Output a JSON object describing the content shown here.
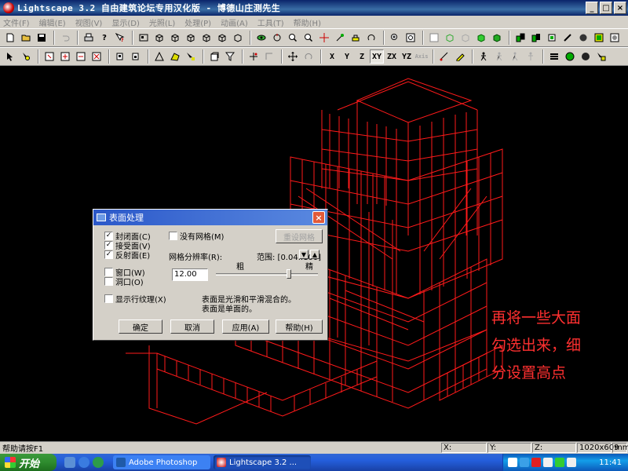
{
  "window": {
    "title": "Lightscape 3.2  自由建筑论坛专用汉化版  - 博德山庄测先生",
    "controls": [
      "_",
      "□",
      "×"
    ]
  },
  "menu": [
    "文件(F)",
    "编辑(E)",
    "视图(V)",
    "显示(D)",
    "光照(L)",
    "处理(P)",
    "动画(A)",
    "工具(T)",
    "帮助(H)"
  ],
  "toolbar2": {
    "axis_buttons": [
      "X",
      "Y",
      "Z",
      "XY",
      "ZX",
      "YZ",
      "Axis"
    ]
  },
  "annotation": {
    "lines": [
      "再将一些大面",
      "勾选出来，细",
      "分设置高点"
    ],
    "color": "#ff3030"
  },
  "dialog": {
    "title": "表面处理",
    "close_label": "×",
    "checks": {
      "closed": {
        "label": "封闭面(C)",
        "checked": "✓"
      },
      "receive": {
        "label": "接受面(V)",
        "checked": "✓"
      },
      "reflect": {
        "label": "反射面(E)",
        "checked": "✓"
      },
      "no_mesh": {
        "label": "没有网格(M)",
        "checked": ""
      },
      "window": {
        "label": "窗口(W)",
        "checked": ""
      },
      "hole": {
        "label": "洞口(O)",
        "checked": ""
      },
      "texture": {
        "label": "显示行纹理(X)",
        "checked": ""
      }
    },
    "reset_mesh": "重设网格",
    "mesh_res_label": "网格分辨率(R):",
    "range_label": "范围: [0.04..100]",
    "coarse": "粗",
    "fine": "精",
    "mesh_value": "12.00",
    "slider_level": 0.72,
    "info1": "表面是光滑和平滑混合的。",
    "info2": "表面是单面的。",
    "ok": "确定",
    "cancel": "取消",
    "apply": "应用(A)",
    "help": "帮助(H)"
  },
  "statusbar": {
    "help": "帮助请按F1",
    "x": "X:",
    "y": "Y:",
    "z": "Z:",
    "resolution": "1020x609",
    "unit": "mm"
  },
  "taskbar": {
    "start": "开始",
    "task1": "Adobe Photoshop",
    "task2": "Lightscape 3.2 ...",
    "clock": "11:41"
  }
}
